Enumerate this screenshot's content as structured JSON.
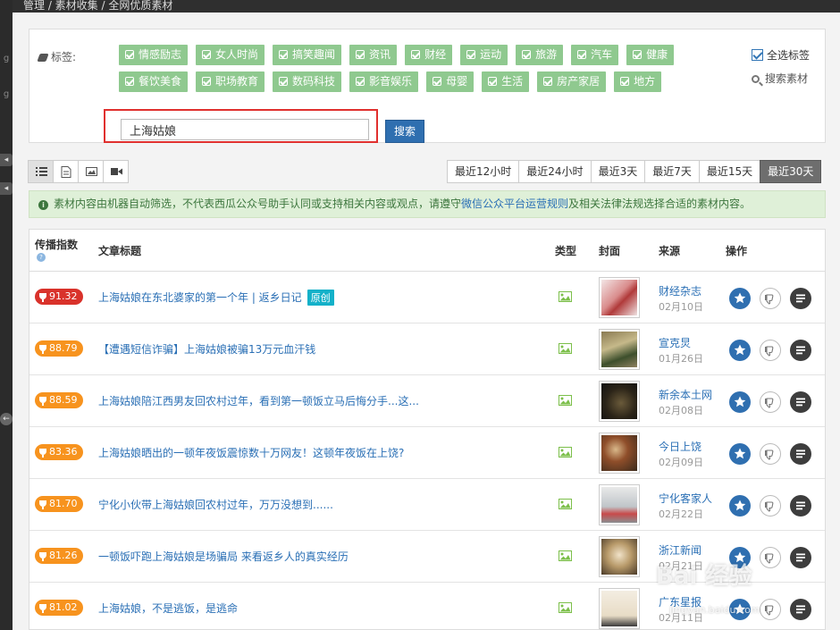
{
  "breadcrumb": "管理 / 素材收集 / 全网优质素材",
  "tags": {
    "label": "标签:",
    "items": [
      "情感励志",
      "女人时尚",
      "搞笑趣闻",
      "资讯",
      "财经",
      "运动",
      "旅游",
      "汽车",
      "健康",
      "餐饮美食",
      "职场教育",
      "数码科技",
      "影音娱乐",
      "母婴",
      "生活",
      "房产家居",
      "地方"
    ],
    "select_all": "全选标签",
    "search_material": "搜索素材"
  },
  "search": {
    "value": "上海姑娘",
    "button": "搜索"
  },
  "view_buttons": [
    "list-icon",
    "document-icon",
    "image-icon",
    "video-icon"
  ],
  "time_ranges": {
    "items": [
      "最近12小时",
      "最近24小时",
      "最近3天",
      "最近7天",
      "最近15天",
      "最近30天"
    ],
    "active": "最近30天"
  },
  "notice": {
    "before": "素材内容由机器自动筛选，不代表西瓜公众号助手认同或支持相关内容或观点，请遵守",
    "link": "微信公众平台运营规则",
    "after": "及相关法律法规选择合适的素材内容。"
  },
  "table": {
    "headers": {
      "spread": "传播指数",
      "title": "文章标题",
      "type": "类型",
      "cover": "封面",
      "source": "来源",
      "actions": "操作"
    },
    "rows": [
      {
        "score": "91.32",
        "title": "上海姑娘在东北婆家的第一个年 | 返乡日记",
        "badge": "原创",
        "source": "财经杂志",
        "date": "02月10日"
      },
      {
        "score": "88.79",
        "title": "【遭遇短信诈骗】上海姑娘被骗13万元血汗钱",
        "badge": "",
        "source": "宣克炅",
        "date": "01月26日"
      },
      {
        "score": "88.59",
        "title": "上海姑娘陪江西男友回农村过年，看到第一顿饭立马后悔分手...这...",
        "badge": "",
        "source": "新余本土网",
        "date": "02月08日"
      },
      {
        "score": "83.36",
        "title": "上海姑娘晒出的一顿年夜饭震惊数十万网友！这顿年夜饭在上饶?",
        "badge": "",
        "source": "今日上饶",
        "date": "02月09日"
      },
      {
        "score": "81.70",
        "title": "宁化小伙带上海姑娘回农村过年，万万没想到......",
        "badge": "",
        "source": "宁化客家人",
        "date": "02月22日"
      },
      {
        "score": "81.26",
        "title": "一顿饭吓跑上海姑娘是场骗局 来看返乡人的真实经历",
        "badge": "",
        "source": "浙江新闻",
        "date": "02月21日"
      },
      {
        "score": "81.02",
        "title": "上海姑娘，不是逃饭，是逃命",
        "badge": "",
        "source": "广东星报",
        "date": "02月11日"
      }
    ]
  },
  "watermark": {
    "main": "Bai 经验",
    "sub": "jingyan.baidu.com"
  },
  "colors": {
    "tag_green": "#8fc98f",
    "score_red": "#d9322b",
    "score_orange": "#f7931e",
    "link_blue": "#2a6fb5",
    "notice_bg": "#dff0d8",
    "search_outline": "#e0302e"
  }
}
